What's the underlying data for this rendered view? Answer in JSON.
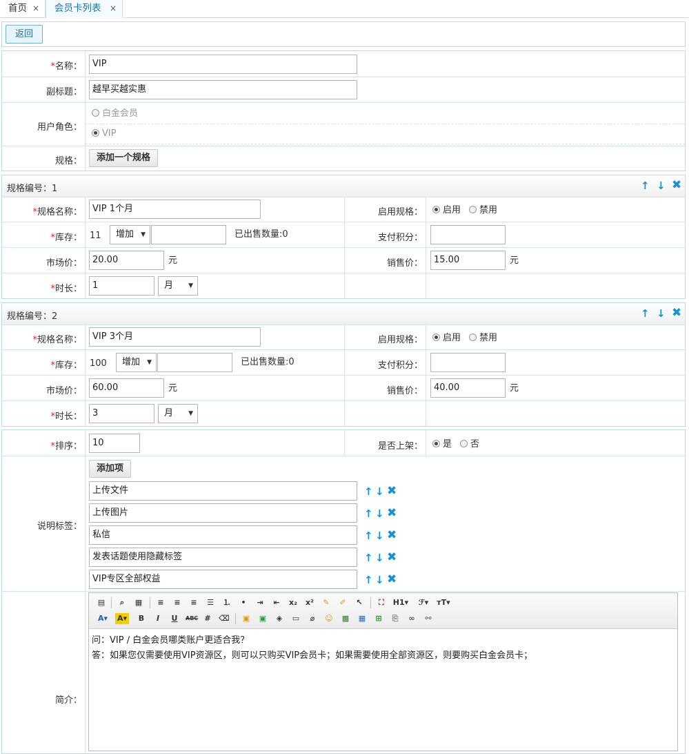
{
  "tabs": {
    "home": "首页",
    "active": "会员卡列表",
    "close": "×"
  },
  "toolbar": {
    "back_label": "返回"
  },
  "form": {
    "name_label": "名称：",
    "name_value": "VIP",
    "subtitle_label": "副标题：",
    "subtitle_value": "越早买越实惠",
    "role_label": "用户角色：",
    "roles": [
      "白金会员",
      "VIP"
    ],
    "spec_label": "规格：",
    "add_spec_btn": "添加一个规格"
  },
  "specs": [
    {
      "title": "规格编号：1",
      "name_label": "规格名称：",
      "name_value": "VIP 1个月",
      "enable_label": "启用规格：",
      "enable_on": "启用",
      "enable_off": "禁用",
      "stock_label": "库存：",
      "stock_value": "11",
      "stock_op": "增加",
      "sold_text": "已出售数量:0",
      "points_label": "支付积分：",
      "market_label": "市场价：",
      "market_value": "20.00",
      "unit": "元",
      "sale_label": "销售价：",
      "sale_value": "15.00",
      "duration_label": "时长：",
      "duration_value": "1",
      "duration_unit": "月"
    },
    {
      "title": "规格编号：2",
      "name_label": "规格名称：",
      "name_value": "VIP 3个月",
      "enable_label": "启用规格：",
      "enable_on": "启用",
      "enable_off": "禁用",
      "stock_label": "库存：",
      "stock_value": "100",
      "stock_op": "增加",
      "sold_text": "已出售数量:0",
      "points_label": "支付积分：",
      "market_label": "市场价：",
      "market_value": "60.00",
      "unit": "元",
      "sale_label": "销售价：",
      "sale_value": "40.00",
      "duration_label": "时长：",
      "duration_value": "3",
      "duration_unit": "月"
    }
  ],
  "bottom": {
    "sort_label": "排序：",
    "sort_value": "10",
    "shelf_label": "是否上架：",
    "shelf_yes": "是",
    "shelf_no": "否",
    "tags_label": "说明标签：",
    "add_item_btn": "添加项",
    "tags": [
      "上传文件",
      "上传图片",
      "私信",
      "发表话题使用隐藏标签",
      "VIP专区全部权益"
    ],
    "intro_label": "简介：",
    "intro_lines": [
      "问：VIP / 白金会员哪类账户更适合我？",
      "答：如果您仅需要使用VIP资源区，则可以只购买VIP会员卡；如果需要使用全部资源区，则要购买白金会员卡；"
    ]
  },
  "required_mark": "*",
  "icons": {
    "up": "↑",
    "down": "↓",
    "delete": "✖",
    "caret": "▼"
  },
  "colors": {
    "accent": "#1592d6",
    "required": "#e02020",
    "border": "#b9daea"
  }
}
